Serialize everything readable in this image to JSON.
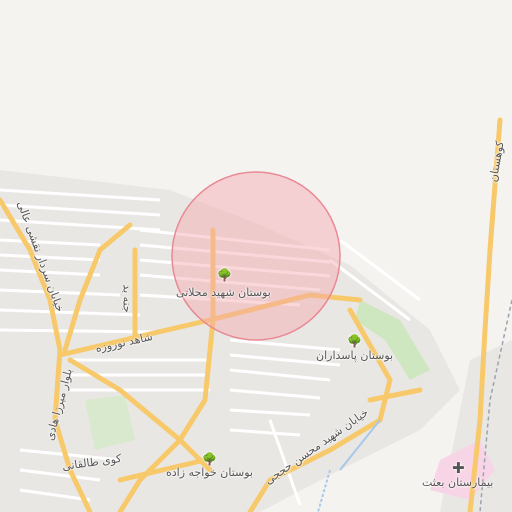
{
  "map": {
    "labels": {
      "park_mahallati": "بوستان شهید محلاتی",
      "park_pasdaran": "بوستان پاسداران",
      "park_khajezadeh": "بوستان خواجه زاده",
      "hospital_besat": "بیمارستان بعثت",
      "street_mohsen_hojaji": "خیابان شهید محسن حججی",
      "street_noroozi": "شاهد نوروزه",
      "street_jenna": "جنه بد",
      "street_taleghani": "کوی طالقانی",
      "street_mirza": "بلوار میرزا هادی",
      "street_sardar": "خیابان سردار نقشی عالی",
      "street_kohestan": "کوهستان"
    },
    "icons": {
      "tree": "tree-icon",
      "hospital": "hospital-cross-icon"
    },
    "colors": {
      "background": "#f5f3f0",
      "residential": "#e8e6e3",
      "road_major": "#f7c96a",
      "road_minor": "#ffffff",
      "park": "#cfe7c0",
      "hospital_area": "#f8d5e6",
      "water": "#a7c8ea",
      "highlight_circle": "#f4a6ad"
    }
  }
}
